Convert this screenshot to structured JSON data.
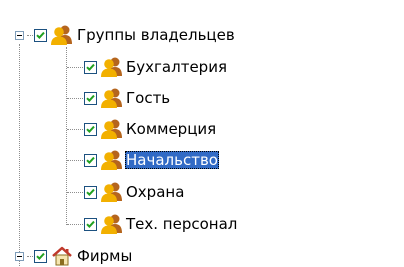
{
  "tree": {
    "groups": {
      "label": "Группы владельцев",
      "expanded": true,
      "checked": true,
      "icon": "users-group-icon",
      "children": [
        {
          "label": "Бухгалтерия",
          "checked": true,
          "icon": "users-group-icon",
          "selected": false
        },
        {
          "label": "Гость",
          "checked": true,
          "icon": "users-group-icon",
          "selected": false
        },
        {
          "label": "Коммерция",
          "checked": true,
          "icon": "users-group-icon",
          "selected": false
        },
        {
          "label": "Начальство",
          "checked": true,
          "icon": "users-group-icon",
          "selected": true
        },
        {
          "label": "Охрана",
          "checked": true,
          "icon": "users-group-icon",
          "selected": false
        },
        {
          "label": "Тех. персонал",
          "checked": true,
          "icon": "users-group-icon",
          "selected": false
        }
      ]
    },
    "firms": {
      "label": "Фирмы",
      "expanded": true,
      "checked": true,
      "icon": "home-icon"
    }
  },
  "colors": {
    "selection": "#316ac5",
    "checkmark": "#21a121",
    "checkbox_border": "#1c5180",
    "tree_line": "#8e8e8e"
  }
}
